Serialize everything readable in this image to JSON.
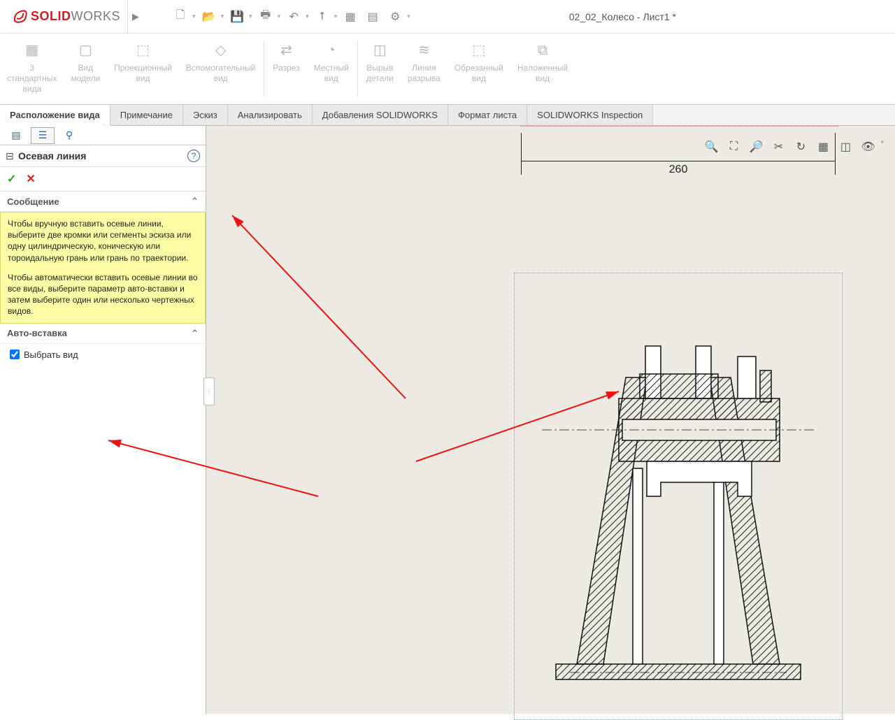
{
  "app": {
    "doc_title": "02_02_Колесо - Лист1 *"
  },
  "logo": {
    "bold": "SOLID",
    "thin": "WORKS"
  },
  "ribbon": [
    {
      "label": "3\nстандартных\nвида"
    },
    {
      "label": "Вид\nмодели"
    },
    {
      "label": "Проекционный\nвид"
    },
    {
      "label": "Вспомогательный\nвид"
    },
    {
      "label": "Разрез"
    },
    {
      "label": "Местный\nвид"
    },
    {
      "label": "Вырыв\nдетали"
    },
    {
      "label": "Линия\nразрыва"
    },
    {
      "label": "Обрезанный\nвид"
    },
    {
      "label": "Наложенный\nвид"
    }
  ],
  "tabs": [
    "Расположение вида",
    "Примечание",
    "Эскиз",
    "Анализировать",
    "Добавления SOLIDWORKS",
    "Формат листа",
    "SOLIDWORKS Inspection"
  ],
  "property": {
    "title": "Осевая линия",
    "msg_header": "Сообщение",
    "msg_p1": "Чтобы вручную вставить осевые линии, выберите две кромки или сегменты эскиза или одну цилиндрическую, коническую или тороидальную грань или грань по траектории.",
    "msg_p2": "Чтобы автоматически вставить осевые линии во все виды, выберите параметр авто-вставки и затем выберите один или несколько чертежных видов.",
    "auto_header": "Авто-вставка",
    "select_view": "Выбрать вид"
  },
  "dimension": {
    "value": "260"
  }
}
